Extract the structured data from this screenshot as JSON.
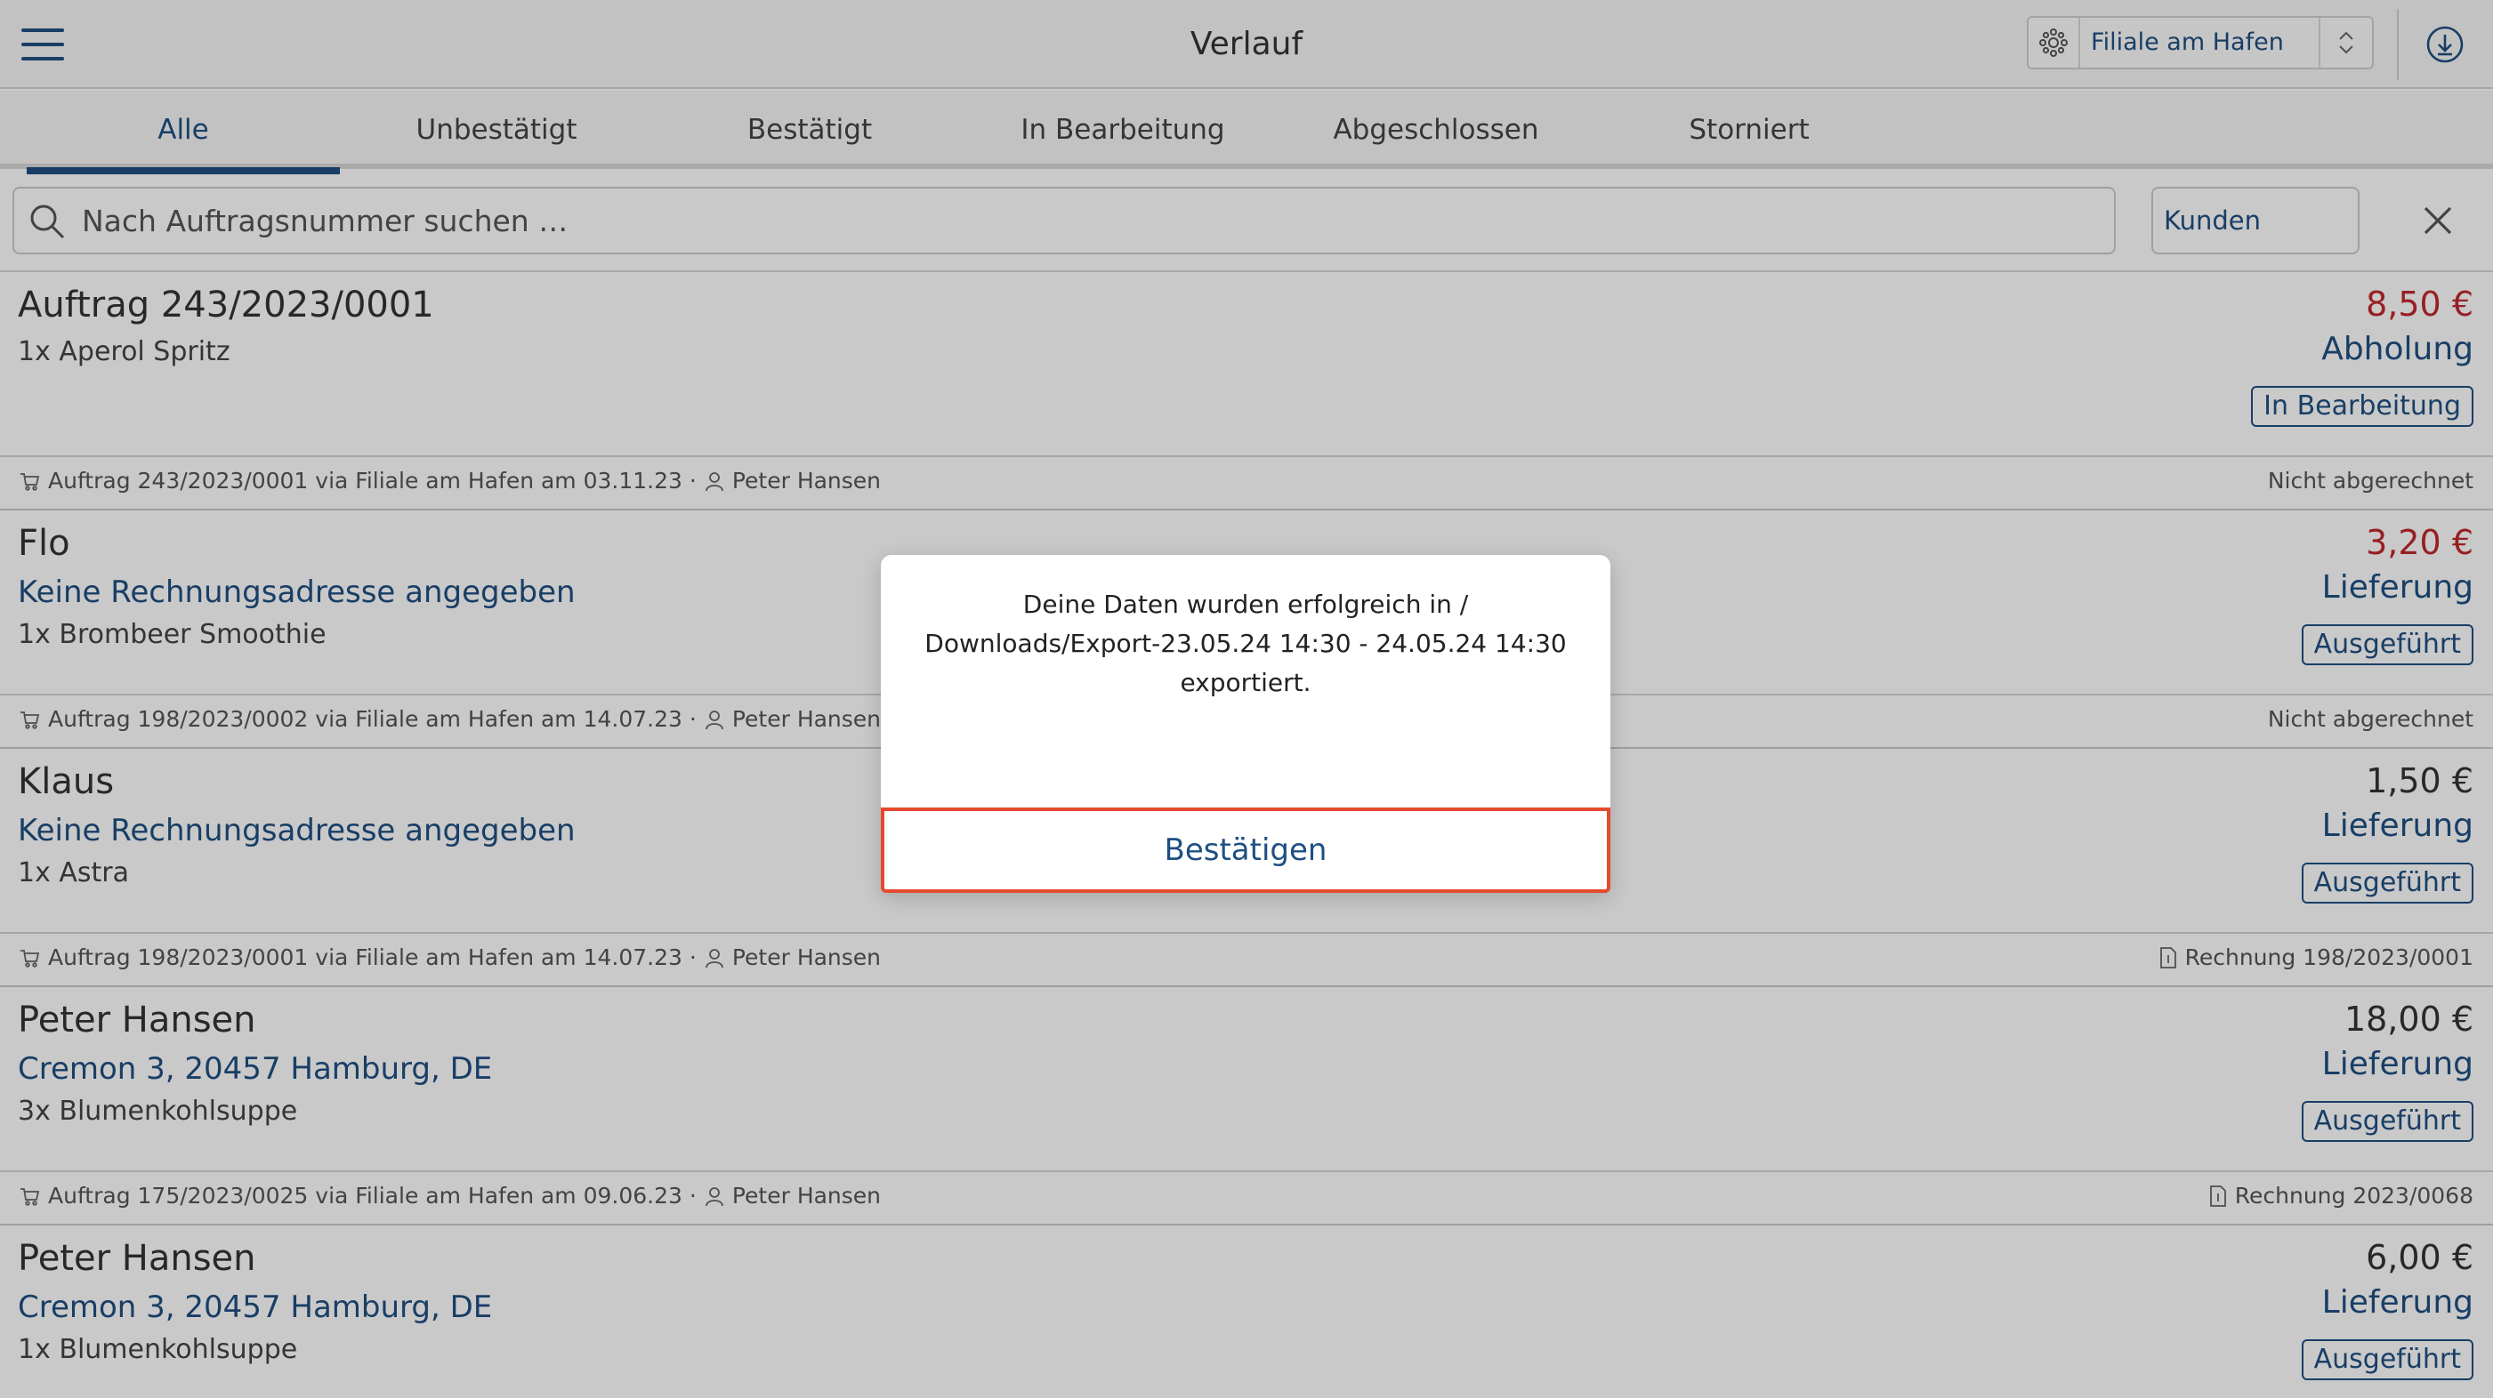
{
  "header": {
    "title": "Verlauf",
    "branch": "Filiale am Hafen"
  },
  "tabs": [
    "Alle",
    "Unbestätigt",
    "Bestätigt",
    "In Bearbeitung",
    "Abgeschlossen",
    "Storniert"
  ],
  "search": {
    "placeholder": "Nach Auftragsnummer suchen …",
    "customer_button": "Kunden"
  },
  "orders": [
    {
      "name": "Auftrag 243/2023/0001",
      "address": "",
      "item": "1x Aperol Spritz",
      "price": "8,50 €",
      "type": "Abholung",
      "status": "In Bearbeitung",
      "meta_left": "Auftrag 243/2023/0001 via Filiale am Hafen am 03.11.23 ·",
      "meta_user": "Peter Hansen",
      "meta_right": "Nicht abgerechnet"
    },
    {
      "name": "Flo",
      "address": "Keine Rechnungsadresse angegeben",
      "item": "1x Brombeer Smoothie",
      "price": "3,20 €",
      "type": "Lieferung",
      "status": "Ausgeführt",
      "meta_left": "Auftrag 198/2023/0002 via Filiale am Hafen am 14.07.23 ·",
      "meta_user": "Peter Hansen",
      "meta_right": "Nicht abgerechnet"
    },
    {
      "name": "Klaus",
      "address": "Keine Rechnungsadresse angegeben",
      "item": "1x Astra",
      "price": "1,50 €",
      "type": "Lieferung",
      "status": "Ausgeführt",
      "meta_left": "Auftrag 198/2023/0001 via Filiale am Hafen am 14.07.23 ·",
      "meta_user": "Peter Hansen",
      "meta_right": "Rechnung 198/2023/0001"
    },
    {
      "name": "Peter Hansen",
      "address": "Cremon 3, 20457 Hamburg, DE",
      "item": "3x Blumenkohlsuppe",
      "price": "18,00 €",
      "type": "Lieferung",
      "status": "Ausgeführt",
      "meta_left": "Auftrag 175/2023/0025 via Filiale am Hafen am 09.06.23 ·",
      "meta_user": "Peter Hansen",
      "meta_right": "Rechnung 2023/0068"
    },
    {
      "name": "Peter Hansen",
      "address": "Cremon 3, 20457 Hamburg, DE",
      "item": "1x Blumenkohlsuppe",
      "price": "6,00 €",
      "type": "Lieferung",
      "status": "Ausgeführt"
    }
  ],
  "dialog": {
    "line1": "Deine Daten wurden erfolgreich in /",
    "line2": "Downloads/Export-23.05.24 14:30 - 24.05.24 14:30",
    "line3": "exportiert.",
    "confirm": "Bestätigen"
  },
  "colors": {
    "accent": "#1f4f82",
    "price_red": "#c0282d",
    "focus_ring": "#e64a2e"
  }
}
